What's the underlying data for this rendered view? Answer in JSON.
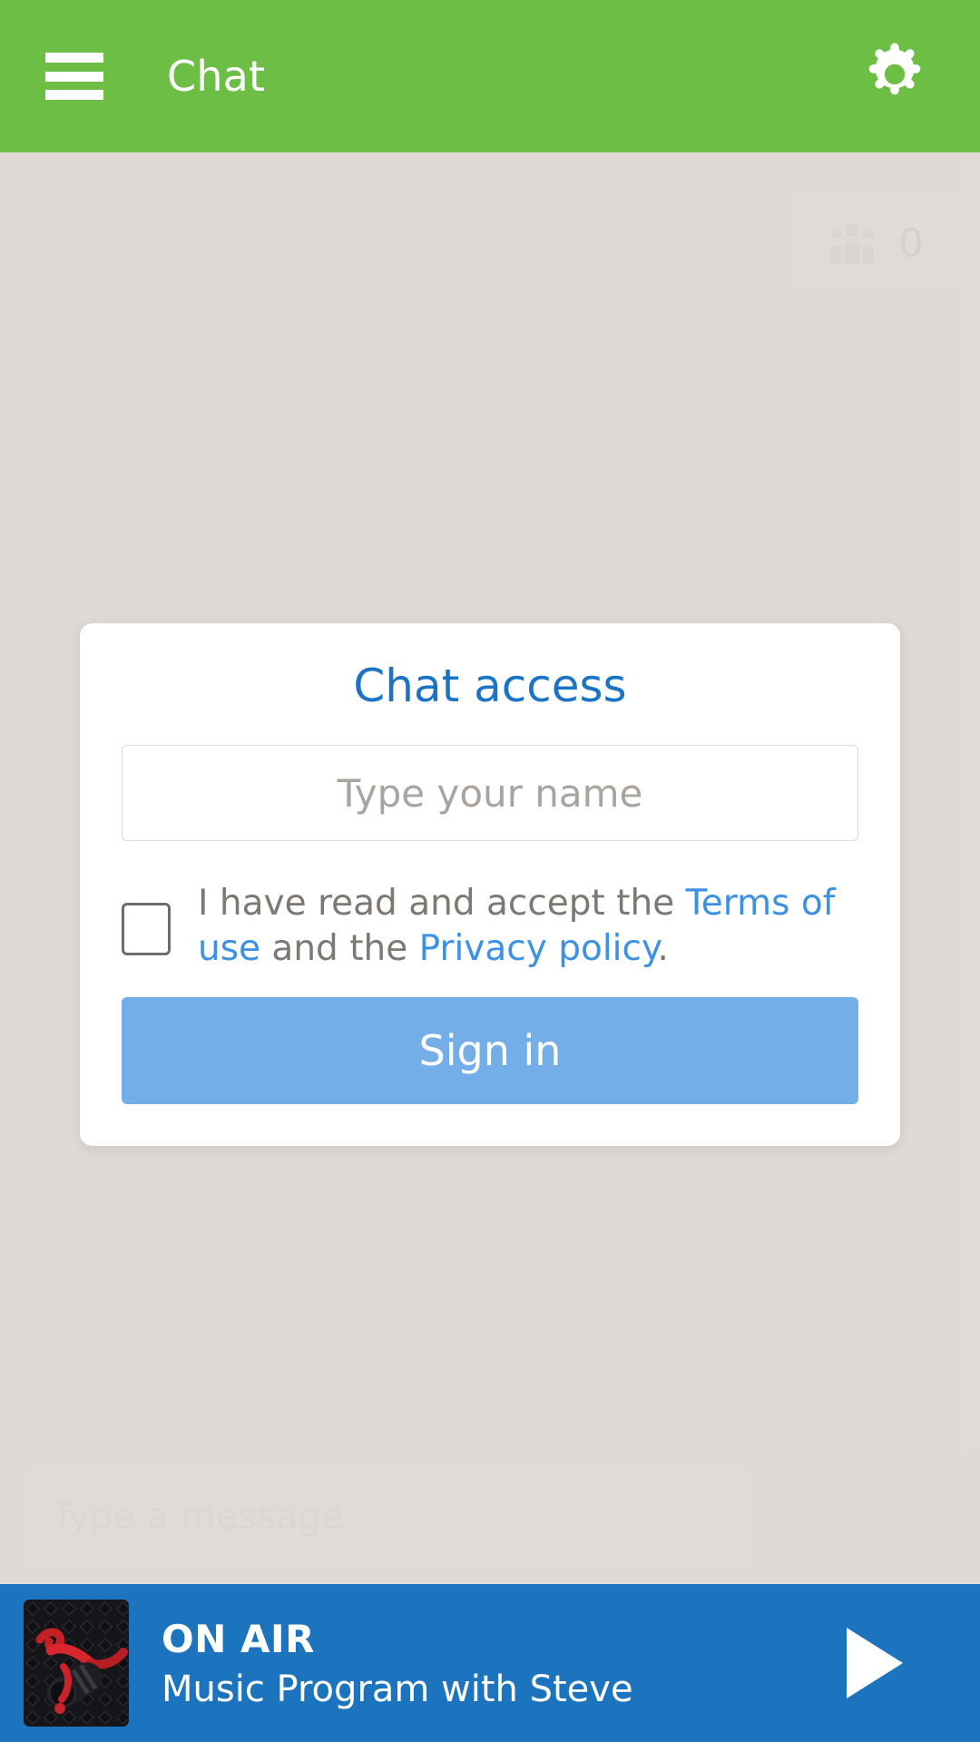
{
  "header": {
    "title": "Chat",
    "menu_icon": "hamburger-menu-icon",
    "settings_icon": "gear-icon",
    "background_color": "#6cbe45"
  },
  "chat": {
    "users_icon": "users-group-icon",
    "users_count": "0",
    "background_color": "#ded9d4"
  },
  "composer": {
    "input_placeholder": "Type a message",
    "input_value": "",
    "send_label": "SEND"
  },
  "dialog": {
    "title": "Chat access",
    "title_color": "#1a73c4",
    "name_placeholder": "Type your name",
    "name_value": "",
    "checkbox_checked": false,
    "terms": {
      "prefix": "I have read and accept the ",
      "terms_link": "Terms of use",
      "middle": " and the ",
      "privacy_link": "Privacy policy",
      "suffix": "."
    },
    "signin_label": "Sign in",
    "signin_color": "#74aee8",
    "link_color": "#3b91e3"
  },
  "player": {
    "status": "ON AIR",
    "program": "Music Program with Steve",
    "thumbnail_icon": "red-microphone-thumbnail",
    "play_icon": "play-icon",
    "background_color": "#1c74be"
  }
}
